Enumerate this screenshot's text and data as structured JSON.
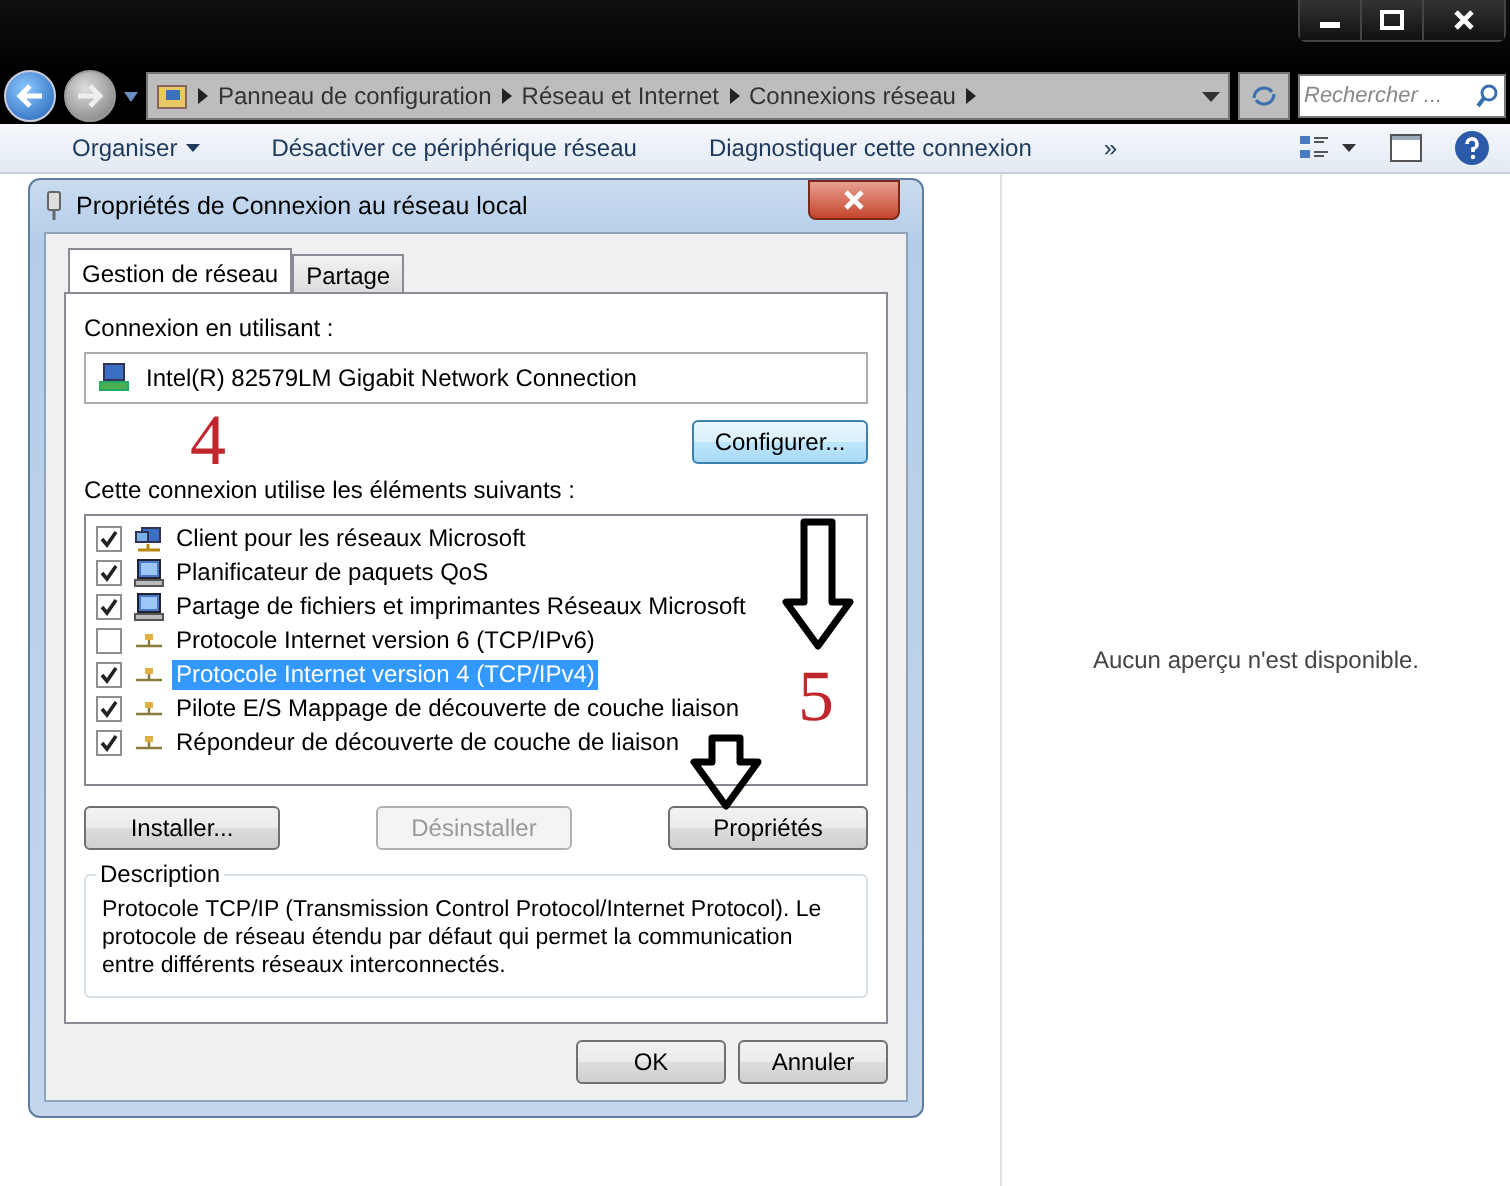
{
  "address_bar": {
    "breadcrumbs": [
      "Panneau de configuration",
      "Réseau et Internet",
      "Connexions réseau"
    ],
    "search": {
      "placeholder": "Rechercher ..."
    }
  },
  "toolbar": {
    "items": [
      {
        "label": "Organiser",
        "dropdown": true
      },
      {
        "label": "Désactiver ce périphérique réseau",
        "dropdown": false
      },
      {
        "label": "Diagnostiquer cette connexion",
        "dropdown": false
      }
    ],
    "overflow": "»"
  },
  "dialog": {
    "title": "Propriétés de Connexion au réseau local",
    "tabs": [
      {
        "label": "Gestion de réseau",
        "selected": true
      },
      {
        "label": "Partage",
        "selected": false
      }
    ],
    "connect_using_label": "Connexion en utilisant :",
    "adapter": "Intel(R) 82579LM Gigabit Network Connection",
    "configure_button": "Configurer...",
    "items_label": "Cette connexion utilise les éléments suivants :",
    "items": [
      {
        "label": "Client pour les réseaux Microsoft",
        "kind": "client",
        "checked": true,
        "selected": false
      },
      {
        "label": "Planificateur de paquets QoS",
        "kind": "service",
        "checked": true,
        "selected": false
      },
      {
        "label": "Partage de fichiers et imprimantes Réseaux Microsoft",
        "kind": "service",
        "checked": true,
        "selected": false
      },
      {
        "label": "Protocole Internet version 6 (TCP/IPv6)",
        "kind": "protocol",
        "checked": false,
        "selected": false
      },
      {
        "label": "Protocole Internet version 4 (TCP/IPv4)",
        "kind": "protocol",
        "checked": true,
        "selected": true
      },
      {
        "label": "Pilote E/S Mappage de découverte de couche liaison",
        "kind": "protocol",
        "checked": true,
        "selected": false
      },
      {
        "label": "Répondeur de découverte de couche de liaison",
        "kind": "protocol",
        "checked": true,
        "selected": false
      }
    ],
    "buttons": [
      {
        "label": "Installer...",
        "disabled": false
      },
      {
        "label": "Désinstaller",
        "disabled": true
      },
      {
        "label": "Propriétés",
        "disabled": false
      }
    ],
    "description": {
      "legend": "Description",
      "text": "Protocole TCP/IP (Transmission Control Protocol/Internet Protocol). Le protocole de réseau étendu par défaut qui permet la communication entre différents réseaux interconnectés."
    },
    "footer_buttons": [
      "OK",
      "Annuler"
    ]
  },
  "annotations": [
    {
      "kind": "number",
      "text": "4"
    },
    {
      "kind": "arrow"
    },
    {
      "kind": "number",
      "text": "5"
    },
    {
      "kind": "arrow"
    }
  ],
  "preview_pane": {
    "message": "Aucun aperçu n'est disponible."
  }
}
